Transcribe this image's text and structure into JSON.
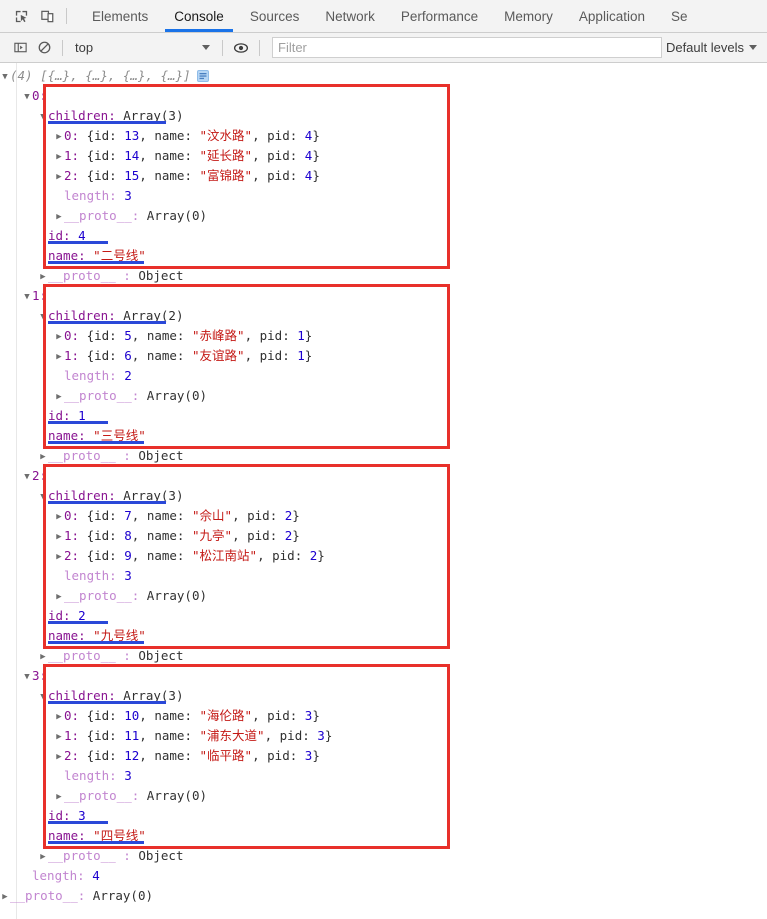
{
  "devtools": {
    "icons": {
      "inspect": "inspect-element-icon",
      "device": "device-toolbar-icon",
      "sidebar": "console-sidebar-icon",
      "clear": "clear-console-icon",
      "eye": "live-expression-eye-icon"
    },
    "tabs": [
      {
        "label": "Elements",
        "active": false
      },
      {
        "label": "Console",
        "active": true
      },
      {
        "label": "Sources",
        "active": false
      },
      {
        "label": "Network",
        "active": false
      },
      {
        "label": "Performance",
        "active": false
      },
      {
        "label": "Memory",
        "active": false
      },
      {
        "label": "Application",
        "active": false
      },
      {
        "label": "Se",
        "active": false
      }
    ],
    "toolbar": {
      "context": "top",
      "filter_value": "",
      "filter_placeholder": "Filter",
      "levels_label": "Default levels"
    }
  },
  "console": {
    "root": {
      "count": "(4)",
      "preview": "[{…}, {…}, {…}, {…}]",
      "length_key": "length:",
      "length_value": "4",
      "proto_key": "__proto__:",
      "proto_value": "Array(0)"
    },
    "labels": {
      "children_key": "children:",
      "length_key": "length:",
      "proto_key": "__proto__:",
      "proto_obj_key": "__proto__",
      "proto_obj_sep": ":",
      "proto_obj_value": "Object",
      "id_key": "id:",
      "name_key": "name:",
      "open_brace": "{",
      "close_brace": "}",
      "comma": ",",
      "colon": ":",
      "k_id": "id:",
      "k_name": "name:",
      "k_pid": "pid:"
    },
    "groups": [
      {
        "index": "0:",
        "children_type": "Array(3)",
        "children": [
          {
            "idx": "0:",
            "id": "13",
            "name": "\"汶水路\"",
            "pid": "4"
          },
          {
            "idx": "1:",
            "id": "14",
            "name": "\"延长路\"",
            "pid": "4"
          },
          {
            "idx": "2:",
            "id": "15",
            "name": "\"富锦路\"",
            "pid": "4"
          }
        ],
        "children_length": "3",
        "children_proto": "Array(0)",
        "id": "4",
        "name": "\"二号线\""
      },
      {
        "index": "1:",
        "children_type": "Array(2)",
        "children": [
          {
            "idx": "0:",
            "id": "5",
            "name": "\"赤峰路\"",
            "pid": "1"
          },
          {
            "idx": "1:",
            "id": "6",
            "name": "\"友谊路\"",
            "pid": "1"
          }
        ],
        "children_length": "2",
        "children_proto": "Array(0)",
        "id": "1",
        "name": "\"三号线\""
      },
      {
        "index": "2:",
        "children_type": "Array(3)",
        "children": [
          {
            "idx": "0:",
            "id": "7",
            "name": "\"佘山\"",
            "pid": "2"
          },
          {
            "idx": "1:",
            "id": "8",
            "name": "\"九亭\"",
            "pid": "2"
          },
          {
            "idx": "2:",
            "id": "9",
            "name": "\"松江南站\"",
            "pid": "2"
          }
        ],
        "children_length": "3",
        "children_proto": "Array(0)",
        "id": "2",
        "name": "\"九号线\""
      },
      {
        "index": "3:",
        "children_type": "Array(3)",
        "children": [
          {
            "idx": "0:",
            "id": "10",
            "name": "\"海伦路\"",
            "pid": "3"
          },
          {
            "idx": "1:",
            "id": "11",
            "name": "\"浦东大道\"",
            "pid": "3"
          },
          {
            "idx": "2:",
            "id": "12",
            "name": "\"临平路\"",
            "pid": "3"
          }
        ],
        "children_length": "3",
        "children_proto": "Array(0)",
        "id": "3",
        "name": "\"四号线\""
      }
    ]
  },
  "colors": {
    "accent": "#1a73e8",
    "annotation": "#e8302a",
    "highlight": "#2a48d8",
    "string": "#c41a16",
    "number": "#1c00cf",
    "key": "#881391"
  }
}
